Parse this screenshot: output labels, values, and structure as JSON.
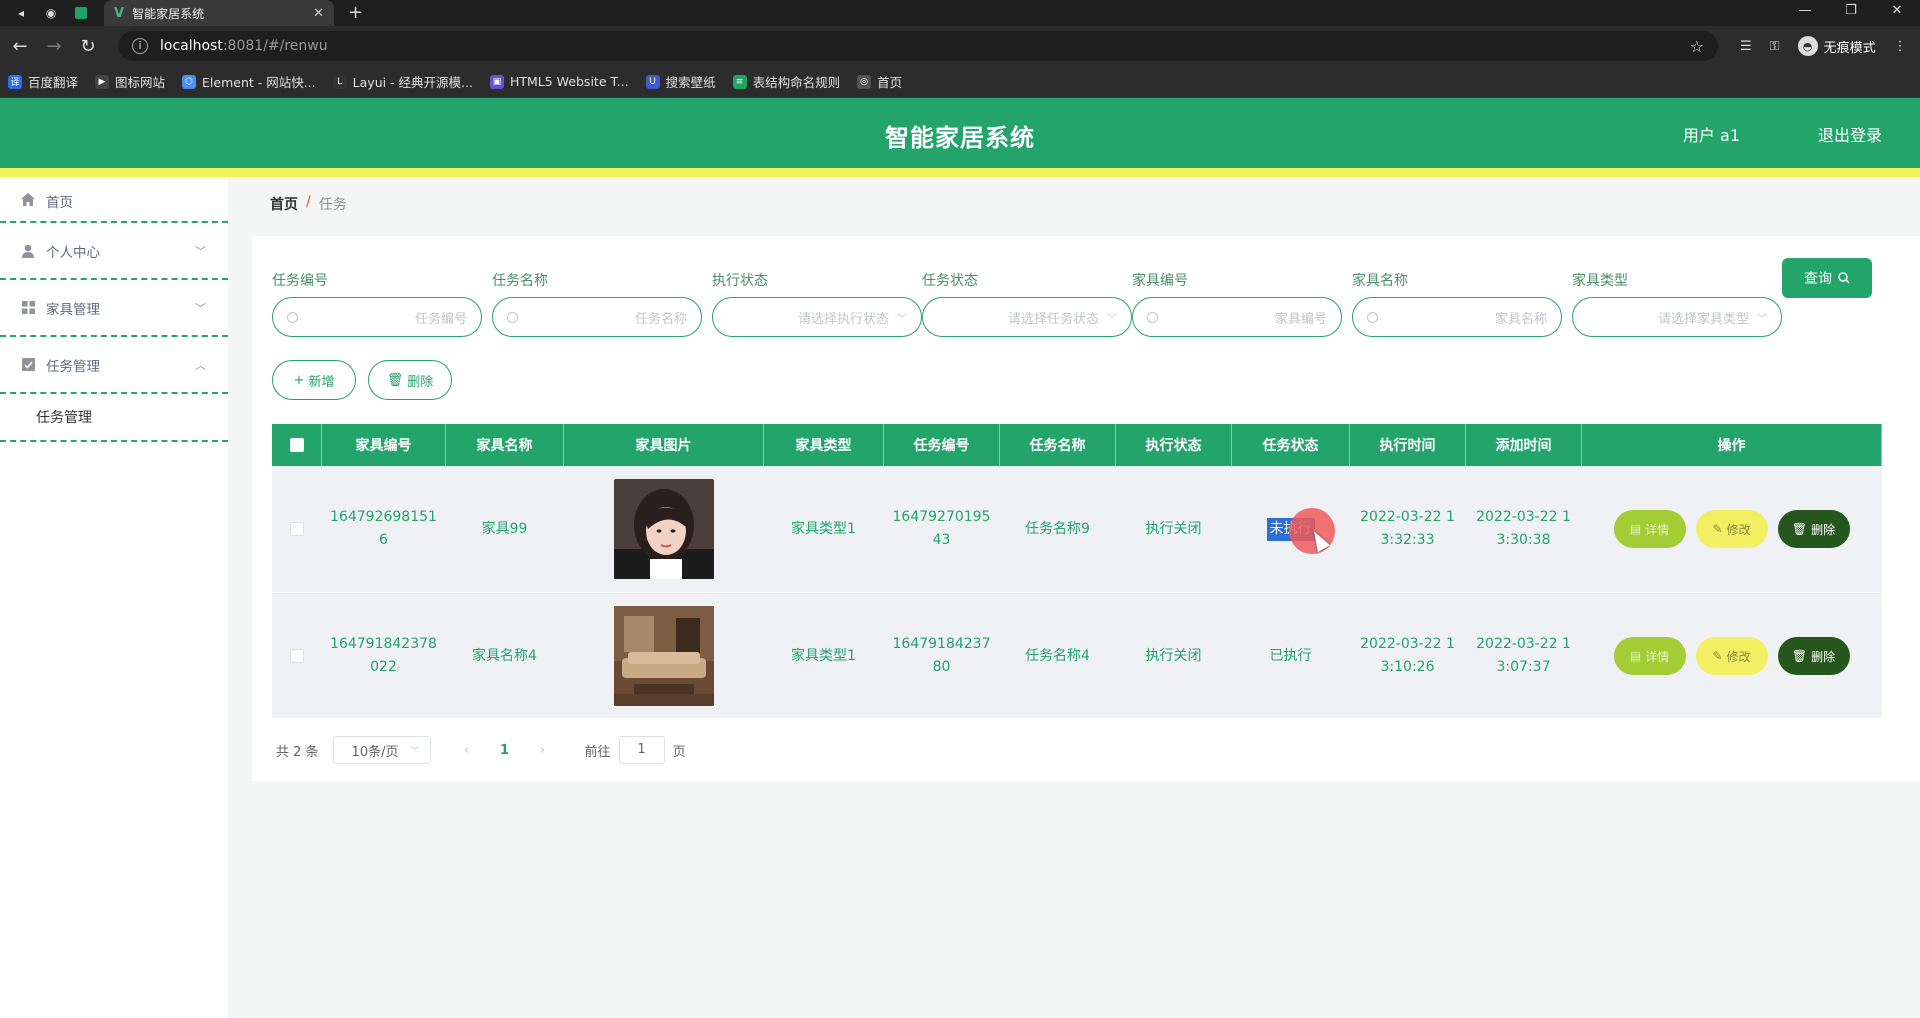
{
  "browser": {
    "tab_title": "智能家居系统",
    "url_host": "localhost",
    "url_path": ":8081/#/renwu",
    "incognito_label": "无痕模式",
    "bookmarks": [
      {
        "label": "百度翻译",
        "color": "#2b6df6",
        "glyph": "译"
      },
      {
        "label": "图标网站",
        "color": "#444444",
        "glyph": "▶"
      },
      {
        "label": "Element - 网站快...",
        "color": "#4a8ef0",
        "glyph": "⬡"
      },
      {
        "label": "Layui - 经典开源模...",
        "color": "#333333",
        "glyph": "L"
      },
      {
        "label": "HTML5 Website T...",
        "color": "#6a4fd8",
        "glyph": "▣"
      },
      {
        "label": "搜索壁纸",
        "color": "#3a5ccc",
        "glyph": "U"
      },
      {
        "label": "表结构命名规则",
        "color": "#1fa463",
        "glyph": "≡"
      },
      {
        "label": "首页",
        "color": "#555555",
        "glyph": "◎"
      }
    ]
  },
  "header": {
    "title": "智能家居系统",
    "user": "用户 a1",
    "logout": "退出登录"
  },
  "sidebar": {
    "items": [
      {
        "label": "首页",
        "icon": "home-icon"
      },
      {
        "label": "个人中心",
        "icon": "user-icon",
        "arrow": "﹀"
      },
      {
        "label": "家具管理",
        "icon": "grid-icon",
        "arrow": "﹀"
      },
      {
        "label": "任务管理",
        "icon": "task-icon",
        "arrow": "︿"
      }
    ],
    "submenu": "任务管理"
  },
  "breadcrumb": {
    "home": "首页",
    "sep": "/",
    "current": "任务"
  },
  "filters": [
    {
      "label": "任务编号",
      "placeholder": "任务编号",
      "kind": "search"
    },
    {
      "label": "任务名称",
      "placeholder": "任务名称",
      "kind": "search"
    },
    {
      "label": "执行状态",
      "placeholder": "请选择执行状态",
      "kind": "select"
    },
    {
      "label": "任务状态",
      "placeholder": "请选择任务状态",
      "kind": "select"
    },
    {
      "label": "家具编号",
      "placeholder": "家具编号",
      "kind": "search"
    },
    {
      "label": "家具名称",
      "placeholder": "家具名称",
      "kind": "search"
    },
    {
      "label": "家具类型",
      "placeholder": "请选择家具类型",
      "kind": "select"
    }
  ],
  "buttons": {
    "query": "查询",
    "add": "新增",
    "delete": "删除"
  },
  "table": {
    "columns": [
      "家具编号",
      "家具名称",
      "家具图片",
      "家具类型",
      "任务编号",
      "任务名称",
      "执行状态",
      "任务状态",
      "执行时间",
      "添加时间",
      "操作"
    ],
    "rows": [
      {
        "furniture_no": "1647926981516",
        "furniture_name": "家具99",
        "image": "portrait",
        "furniture_type": "家具类型1",
        "task_no": "1647927019543",
        "task_name": "任务名称9",
        "exec_status": "执行关闭",
        "task_status": "未执行",
        "exec_time": "2022-03-22 13:32:33",
        "add_time": "2022-03-22 13:30:38"
      },
      {
        "furniture_no": "164791842378022",
        "furniture_name": "家具名称4",
        "image": "sofa-room",
        "furniture_type": "家具类型1",
        "task_no": "1647918423780",
        "task_name": "任务名称4",
        "exec_status": "执行关闭",
        "task_status": "已执行",
        "exec_time": "2022-03-22 13:10:26",
        "add_time": "2022-03-22 13:07:37"
      }
    ],
    "actions": {
      "detail": "详情",
      "edit": "修改",
      "delete": "删除"
    }
  },
  "pagination": {
    "total": "共 2 条",
    "page_size": "10条/页",
    "current_page": "1",
    "goto_label": "前往",
    "goto_value": "1",
    "page_unit": "页"
  },
  "colors": {
    "primary": "#23a46b",
    "accent_bar": "#f2f257"
  }
}
